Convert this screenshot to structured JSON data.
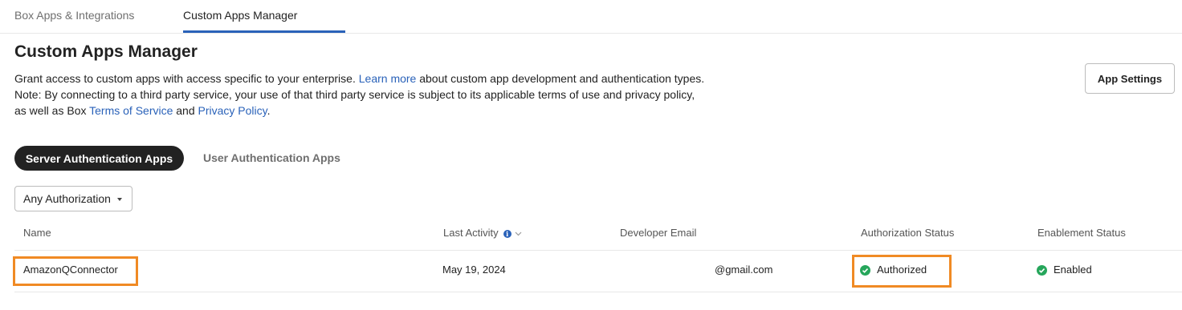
{
  "tabs": [
    {
      "label": "Box Apps & Integrations",
      "active": false
    },
    {
      "label": "Custom Apps Manager",
      "active": true
    }
  ],
  "page": {
    "title": "Custom Apps Manager",
    "description_1": "Grant access to custom apps with access specific to your enterprise. ",
    "learn_more": "Learn more",
    "description_2": " about custom app development and authentication types. Note: By connecting to a third party service, your use of that third party service is subject to its applicable terms of use and privacy policy, as well as Box ",
    "terms_link": "Terms of Service",
    "and_text": " and ",
    "privacy_link": "Privacy Policy",
    "period": "."
  },
  "toolbar": {
    "app_settings_label": "App Settings"
  },
  "auth_tabs": [
    {
      "label": "Server Authentication Apps",
      "active": true
    },
    {
      "label": "User Authentication Apps",
      "active": false
    }
  ],
  "filter": {
    "selected": "Any Authorization"
  },
  "table": {
    "columns": [
      "Name",
      "Last Activity",
      "Developer Email",
      "Authorization Status",
      "Enablement Status"
    ],
    "rows": [
      {
        "name": "AmazonQConnector",
        "last_activity": "May 19, 2024",
        "developer_email": "@gmail.com",
        "authorization_status": "Authorized",
        "enablement_status": "Enabled"
      }
    ]
  },
  "colors": {
    "accent": "#2a62b9",
    "success": "#26a65b",
    "highlight": "#f08a24",
    "dark_pill": "#222222"
  }
}
